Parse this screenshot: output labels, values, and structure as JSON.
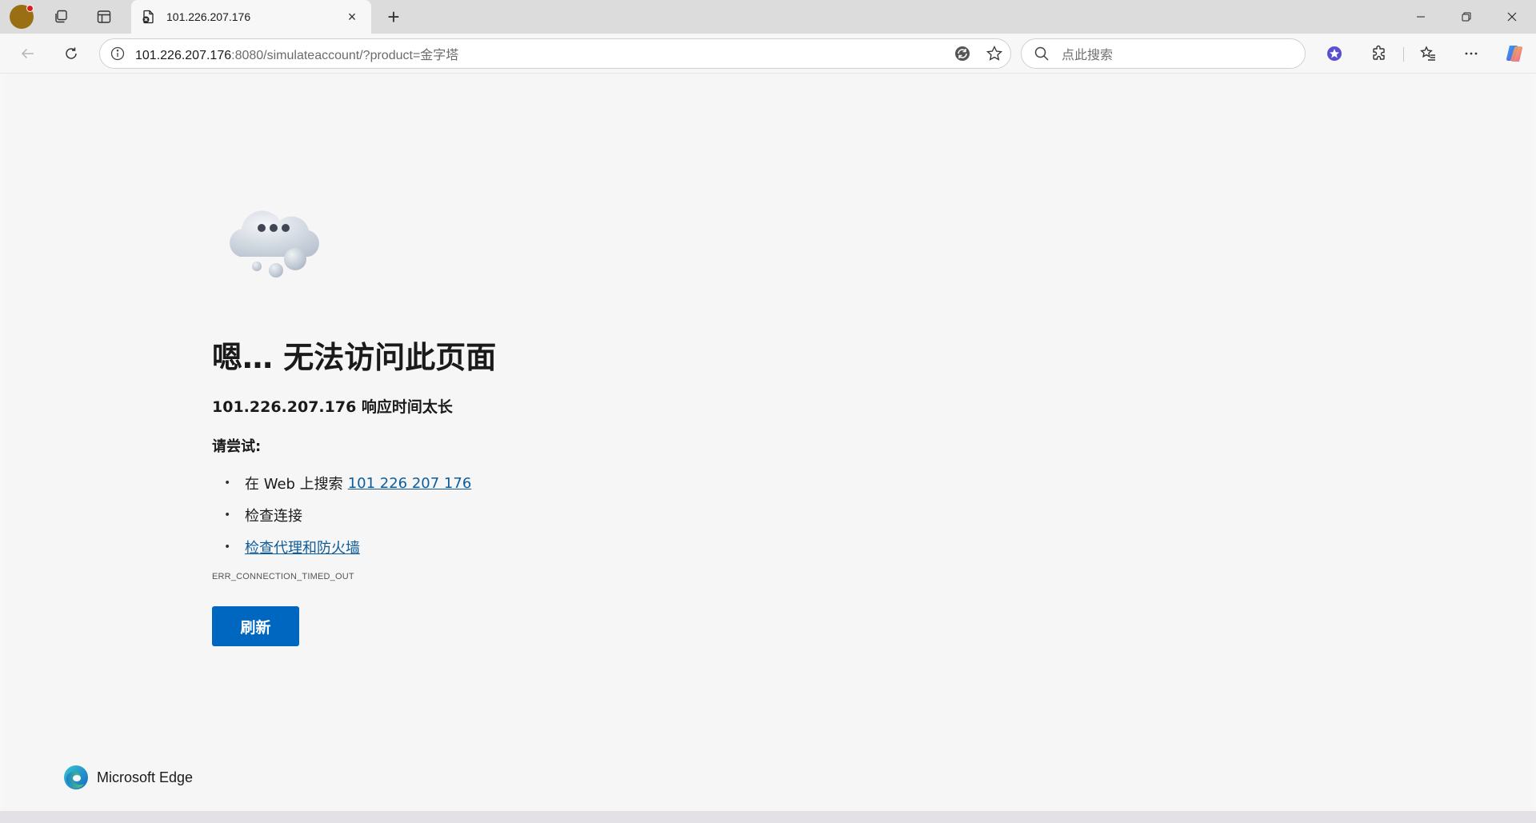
{
  "tab": {
    "title": "101.226.207.176",
    "close_symbol": "×",
    "new_tab_symbol": "+"
  },
  "address": {
    "host": "101.226.207.176",
    "rest": ":8080/simulateaccount/?product=金字塔"
  },
  "search": {
    "placeholder": "点此搜索"
  },
  "error": {
    "headline": "嗯… 无法访问此页面",
    "subline": "101.226.207.176 响应时间太长",
    "try_label": "请尝试:",
    "suggestion_1_prefix": "在 Web 上搜索",
    "suggestion_1_link": "101 226 207 176",
    "suggestion_2": "检查连接",
    "suggestion_3_link": "检查代理和防火墙",
    "code": "ERR_CONNECTION_TIMED_OUT",
    "refresh_label": "刷新"
  },
  "brand": {
    "name": "Microsoft Edge"
  },
  "colors": {
    "accent": "#0067c0",
    "link": "#0f5c99",
    "profile": "#9a6f13"
  }
}
